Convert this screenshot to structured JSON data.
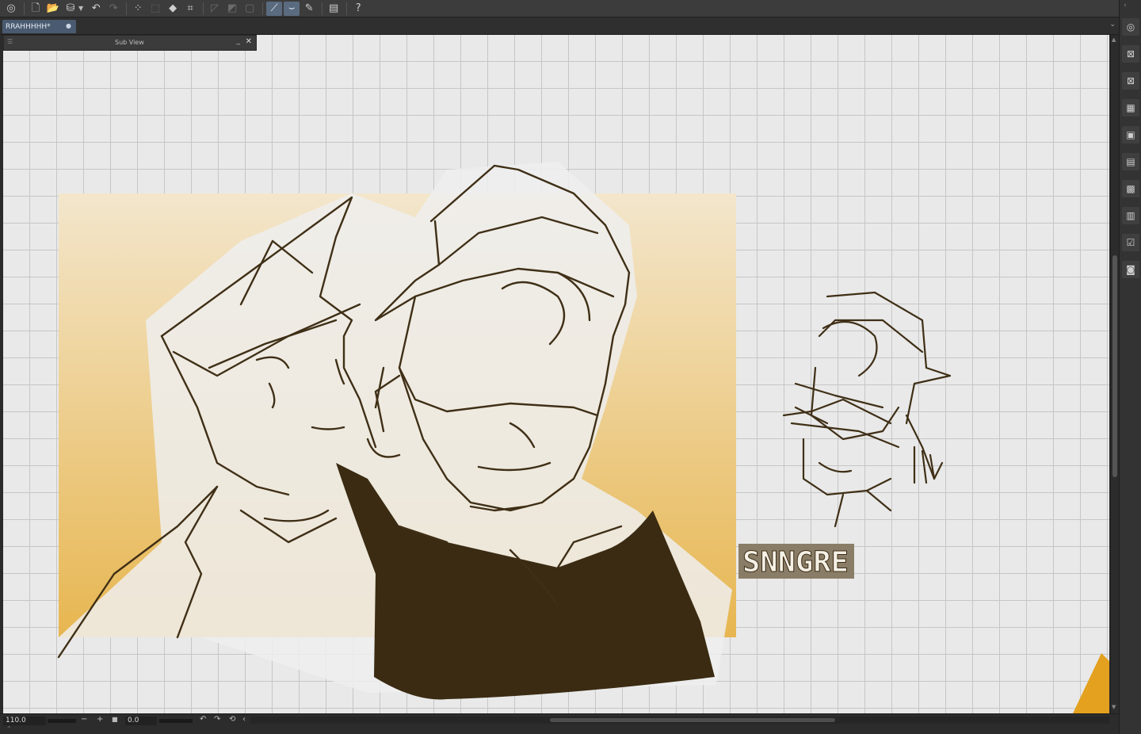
{
  "toolbar": {
    "buttons": [
      {
        "name": "app-logo-icon",
        "glyph": "◎"
      },
      {
        "name": "new-file-icon",
        "glyph": "🗋"
      },
      {
        "name": "open-file-icon",
        "glyph": "📂"
      },
      {
        "name": "save-icon",
        "glyph": "⛁"
      },
      {
        "name": "undo-icon",
        "glyph": "↶"
      },
      {
        "name": "redo-icon",
        "glyph": "↷"
      },
      {
        "name": "select-all-icon",
        "glyph": "⁘"
      },
      {
        "name": "deselect-icon",
        "glyph": "⬚"
      },
      {
        "name": "fill-icon",
        "glyph": "◆"
      },
      {
        "name": "crop-icon",
        "glyph": "⌗"
      },
      {
        "name": "transform-icon",
        "glyph": "◸"
      },
      {
        "name": "correction-icon",
        "glyph": "◩"
      },
      {
        "name": "tone-icon",
        "glyph": "▢"
      },
      {
        "name": "stabilizer-icon",
        "glyph": "⟋"
      },
      {
        "name": "curve-icon",
        "glyph": "⌣"
      },
      {
        "name": "pen-pressure-icon",
        "glyph": "✎"
      },
      {
        "name": "reference-icon",
        "glyph": "▤"
      },
      {
        "name": "help-icon",
        "glyph": "?"
      }
    ]
  },
  "tab": {
    "title": "RRAHHHHH*",
    "close_glyph": "●",
    "chevron_glyph": "⌄"
  },
  "subview": {
    "title": "Sub View",
    "minimize_glyph": "_",
    "close_glyph": "✕",
    "grip_glyph": "☰"
  },
  "artwork": {
    "caption": "SNNGRE",
    "colors": {
      "ink": "#3f2f16",
      "fill": "#3a2b12",
      "gradient_top": "#f3e6cc",
      "gradient_bottom": "#e7b650",
      "paper": "#e9e9e9",
      "grid": "#c6c6c6"
    }
  },
  "statusbar": {
    "zoom_value": "110.0",
    "zoom_minus": "−",
    "zoom_plus": "+",
    "zoom_fit": "■",
    "angle_value": "0.0",
    "rotate_left": "↶",
    "rotate_right": "↷",
    "rotate_reset": "⟲",
    "scroll_left": "‹"
  },
  "rightbar": {
    "collapse_glyph": "‹",
    "buttons": [
      {
        "name": "navigator-icon",
        "glyph": "◎"
      },
      {
        "name": "tool-property-icon",
        "glyph": "⊠"
      },
      {
        "name": "brush-size-icon",
        "glyph": "⊠"
      },
      {
        "name": "color-wheel-icon",
        "glyph": "▦"
      },
      {
        "name": "color-set-icon",
        "glyph": "▣"
      },
      {
        "name": "layer-property-icon",
        "glyph": "▤"
      },
      {
        "name": "material-icon",
        "glyph": "▩"
      },
      {
        "name": "layer-icon",
        "glyph": "▥"
      },
      {
        "name": "history-icon",
        "glyph": "☑"
      },
      {
        "name": "camera-icon",
        "glyph": "◙"
      }
    ]
  }
}
